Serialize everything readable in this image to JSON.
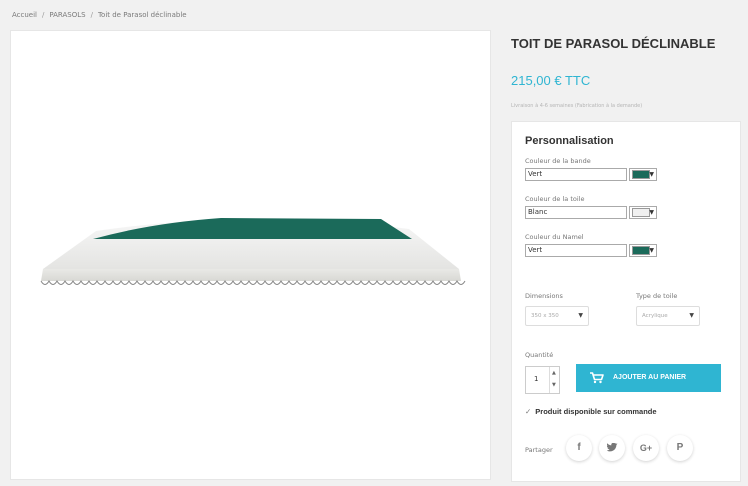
{
  "breadcrumb": [
    "Accueil",
    "PARASOLS",
    "Toit de Parasol déclinable"
  ],
  "product": {
    "title": "TOIT DE PARASOL DÉCLINABLE",
    "price": "215,00 € TTC",
    "delivery_note": "Livraison à 4-6 semaines (Fabrication à la demande)"
  },
  "customization": {
    "title": "Personnalisation",
    "fields": [
      {
        "label": "Couleur de la bande",
        "value": "Vert",
        "swatch": "#1b6a5a"
      },
      {
        "label": "Couleur de la toile",
        "value": "Blanc",
        "swatch": "#f0f0f0"
      },
      {
        "label": "Couleur du Namel",
        "value": "Vert",
        "swatch": "#1b6a5a"
      }
    ],
    "dimensions_label": "Dimensions",
    "dimensions_value": "350 x 350",
    "toile_label": "Type de toile",
    "toile_value": "Acrylique"
  },
  "cart": {
    "quantity_label": "Quantité",
    "quantity": "1",
    "add_label": "AJOUTER AU PANIER"
  },
  "availability": "Produit disponible sur commande",
  "share": {
    "label": "Partager",
    "networks": [
      "f",
      "t",
      "G+",
      "P"
    ]
  },
  "colors": {
    "accent": "#2fb5d2",
    "stripe": "#1b6a5a"
  }
}
